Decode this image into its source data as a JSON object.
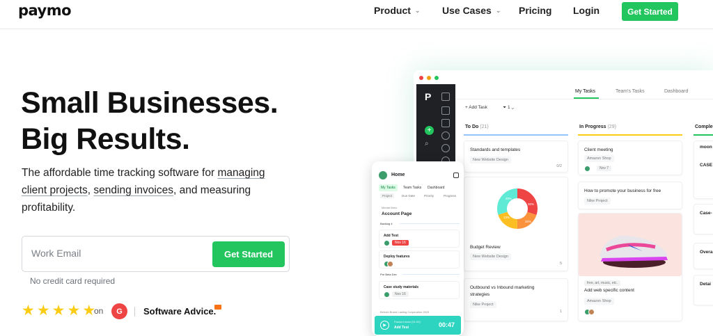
{
  "nav": {
    "logo": "paymo",
    "items": [
      {
        "label": "Product",
        "has_dropdown": true
      },
      {
        "label": "Use Cases",
        "has_dropdown": true
      },
      {
        "label": "Pricing",
        "has_dropdown": false
      },
      {
        "label": "Login",
        "has_dropdown": false
      }
    ],
    "cta": "Get Started"
  },
  "hero": {
    "title_line1": "Small Businesses.",
    "title_line2": "Big Results.",
    "sub_part1": "The affordable time tracking software for ",
    "sub_link1": "managing client projects",
    "sub_part2": ", ",
    "sub_link2": "sending invoices",
    "sub_part3": ", and measuring profitability.",
    "email_placeholder": "Work Email",
    "cta": "Get Started",
    "no_card": "No credit card required",
    "rating_stars": 5,
    "on": "on",
    "g2": "G",
    "software_advice": "Software Advice."
  },
  "app": {
    "tabs": [
      "My Tasks",
      "Team's Tasks",
      "Dashboard"
    ],
    "add_task": "Add Task",
    "filter_count": "1",
    "columns": [
      {
        "name": "To Do",
        "count": "(21)",
        "color": "#93c5fd"
      },
      {
        "name": "In Progress",
        "count": "(29)",
        "color": "#facc15"
      },
      {
        "name": "Comple",
        "count": "",
        "color": "#22c55e"
      }
    ],
    "todo": [
      {
        "title": "Standards and templates",
        "project": "New Website Design",
        "meta": "0/2"
      },
      {
        "title": "Budget Review",
        "project": "New Website Design",
        "meta": "5"
      },
      {
        "title": "Outbound vs Inbound marketing strategies",
        "project": "Nike Project",
        "meta": "1"
      }
    ],
    "donut_labels": [
      "30%",
      "20%",
      "13%",
      "20%"
    ],
    "in_progress": [
      {
        "title": "Client meeting",
        "project": "Amazon Shop",
        "date": "Nov 7"
      },
      {
        "title": "How to promote your business for free",
        "project": "Nike Project"
      },
      {
        "title": "Add web specific content",
        "project": "Amazon Shop",
        "tags": "free, art, music, etc."
      }
    ],
    "complete": [
      "CASE",
      "Case-",
      "Overa",
      "Detai"
    ],
    "complete_logo": "moon"
  },
  "phone": {
    "title": "Home",
    "tabs": [
      "My Tasks",
      "Team Tasks",
      "Dashboard"
    ],
    "sub_tabs": [
      "Project",
      "Due Date",
      "Priority",
      "Progress"
    ],
    "crumb": "Mental Brew",
    "page": "Account Page",
    "section1": "Backlog",
    "section1_count": "4",
    "tasks": [
      "Add Test",
      "Deploy features",
      "Case study materials"
    ],
    "task_date": "Nov 16",
    "section2": "Pre Beta Dev",
    "footer_note": "Behold Brand Lasting Corporation 2023",
    "timer_label": "Paused since (01:00)",
    "timer_task": "Add Test",
    "timer_time": "00:47"
  }
}
